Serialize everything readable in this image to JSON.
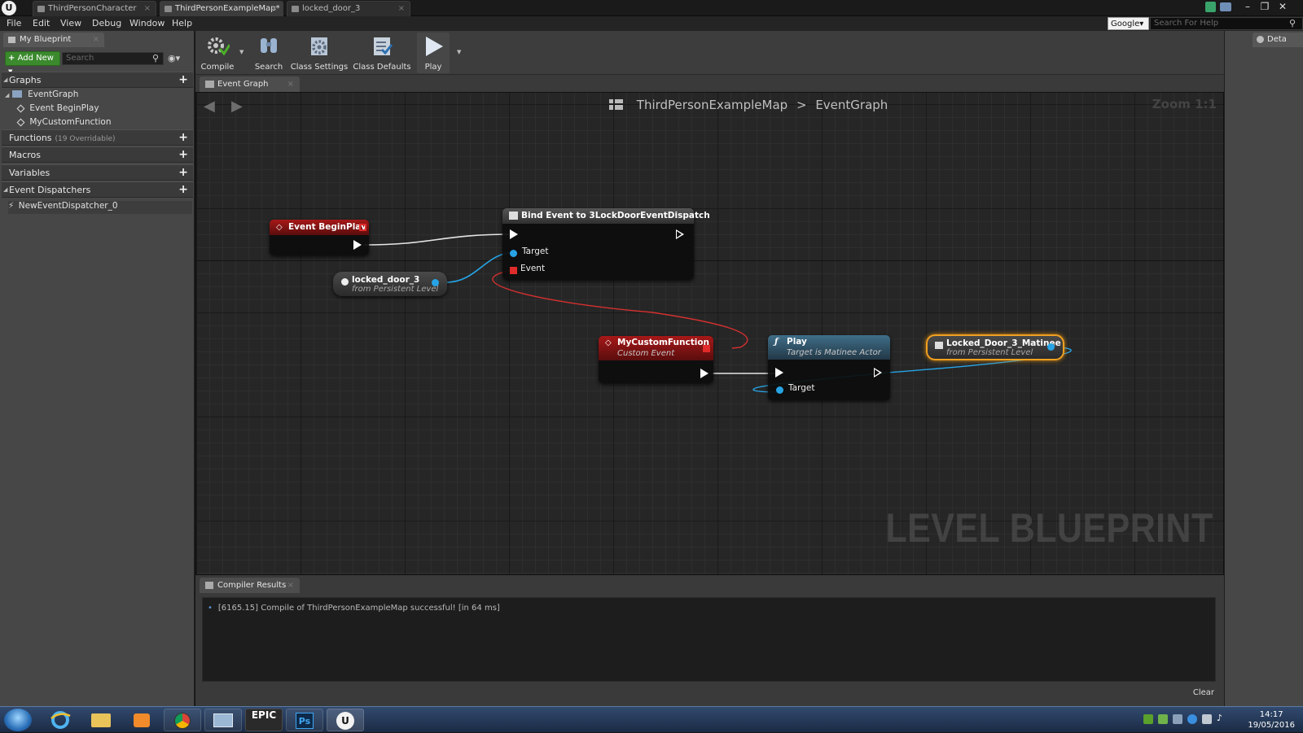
{
  "window": {
    "tabs": [
      {
        "label": "ThirdPersonCharacter",
        "active": false
      },
      {
        "label": "ThirdPersonExampleMap*",
        "active": true
      },
      {
        "label": "locked_door_3",
        "active": false
      }
    ],
    "logo": "U"
  },
  "menu": {
    "items": [
      "File",
      "Edit",
      "View",
      "Debug",
      "Window",
      "Help"
    ],
    "search_provider": "Google▾",
    "help_search_placeholder": "Search For Help"
  },
  "my_blueprint": {
    "tab_label": "My Blueprint",
    "add_new_label": "Add New",
    "search_placeholder": "Search",
    "sections": {
      "graphs": {
        "label": "Graphs",
        "items": [
          "EventGraph",
          "Event BeginPlay",
          "MyCustomFunction"
        ]
      },
      "functions": {
        "label": "Functions",
        "sub": "(19 Overridable)"
      },
      "macros": {
        "label": "Macros"
      },
      "variables": {
        "label": "Variables"
      },
      "event_dispatchers": {
        "label": "Event Dispatchers",
        "items": [
          "NewEventDispatcher_0"
        ]
      }
    }
  },
  "toolbar": {
    "buttons": [
      {
        "label": "Compile",
        "icon": "compile-gear-icon"
      },
      {
        "label": "Search",
        "icon": "binoculars-icon"
      },
      {
        "label": "Class Settings",
        "icon": "class-settings-gear-icon"
      },
      {
        "label": "Class Defaults",
        "icon": "checklist-icon"
      },
      {
        "label": "Play",
        "icon": "play-icon"
      }
    ]
  },
  "graph": {
    "tab_label": "Event Graph",
    "breadcrumb": {
      "map": "ThirdPersonExampleMap",
      "separator": ">",
      "graph": "EventGraph"
    },
    "zoom": "Zoom 1:1",
    "watermark": "LEVEL BLUEPRINT",
    "nodes": {
      "event_beginplay": {
        "title": "Event BeginPlay"
      },
      "locked_door_ref": {
        "title": "locked_door_3",
        "subtitle": "from Persistent Level"
      },
      "bind_event": {
        "title": "Bind Event to 3LockDoorEventDispatch",
        "pins": [
          "Target",
          "Event"
        ]
      },
      "custom_event": {
        "title": "MyCustomFunction",
        "subtitle": "Custom Event"
      },
      "play": {
        "title": "Play",
        "subtitle": "Target is Matinee Actor",
        "pins": [
          "Target"
        ]
      },
      "matinee_ref": {
        "title": "Locked_Door_3_Matinee",
        "subtitle": "from Persistent Level"
      }
    },
    "colors": {
      "event_header": "#a71818",
      "function_header": "#3f6e88",
      "object_pin": "#27a4e6",
      "delegate_pin": "#e02b2b",
      "selection": "#f0a020"
    }
  },
  "compiler": {
    "tab_label": "Compiler Results",
    "log": [
      "[6165.15] Compile of ThirdPersonExampleMap successful! [in 64 ms]"
    ],
    "clear_label": "Clear"
  },
  "details": {
    "tab_label": "Deta"
  },
  "taskbar": {
    "apps": [
      "windows-start-icon",
      "internet-explorer-icon",
      "file-explorer-icon",
      "media-player-icon",
      "chrome-icon",
      "window-manager-icon",
      "epic-launcher-icon",
      "photoshop-icon",
      "unreal-editor-icon"
    ],
    "epic_label": "EPIC",
    "ps_label": "Ps",
    "ue_label": "U",
    "time": "14:17",
    "date": "19/05/2016"
  }
}
